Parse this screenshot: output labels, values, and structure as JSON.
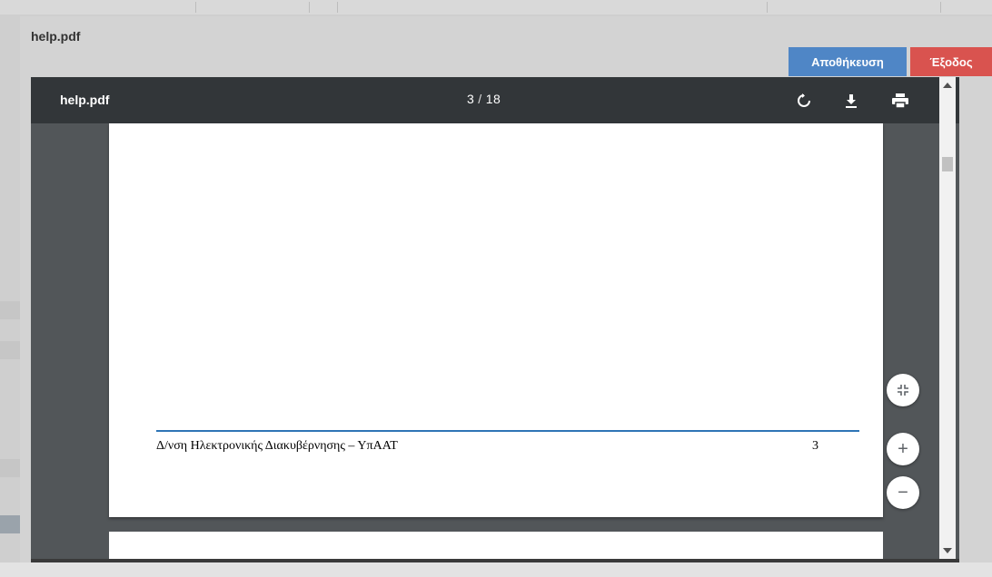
{
  "modal": {
    "title": "help.pdf",
    "save_label": "Αποθήκευση",
    "exit_label": "Έξοδος"
  },
  "viewer": {
    "title": "help.pdf",
    "current_page": "3",
    "separator": "/",
    "total_pages": "18",
    "toolbar_icons": [
      "rotate-icon",
      "download-icon",
      "print-icon"
    ]
  },
  "page": {
    "footer_text": "Δ/νση Ηλεκτρονικής Διακυβέρνησης – ΥπΑΑΤ",
    "page_number": "3"
  },
  "controls": {
    "fit_icon": "fit-to-page-icon",
    "zoom_in": "+",
    "zoom_out": "−"
  },
  "colors": {
    "save_button": "#4f86c6",
    "exit_button": "#d9534f",
    "toolbar": "#323639",
    "viewer_bg": "#525659",
    "footer_rule": "#2e75b6"
  }
}
